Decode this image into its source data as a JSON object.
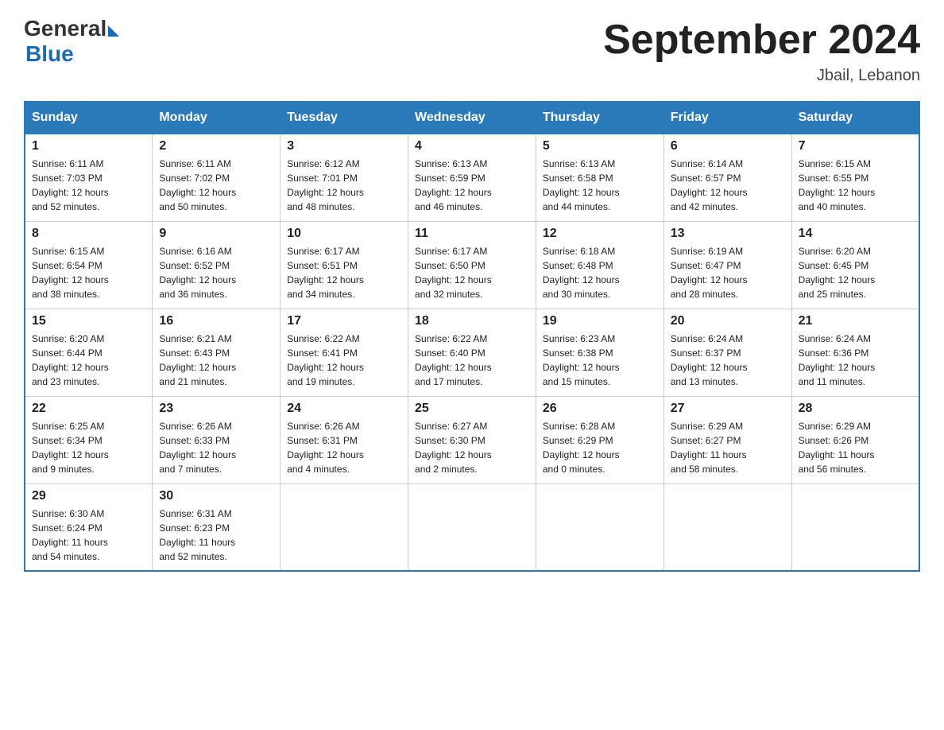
{
  "header": {
    "logo_general": "General",
    "logo_blue": "Blue",
    "title": "September 2024",
    "subtitle": "Jbail, Lebanon"
  },
  "days_of_week": [
    "Sunday",
    "Monday",
    "Tuesday",
    "Wednesday",
    "Thursday",
    "Friday",
    "Saturday"
  ],
  "weeks": [
    [
      {
        "day": "1",
        "sunrise": "6:11 AM",
        "sunset": "7:03 PM",
        "daylight": "12 hours and 52 minutes."
      },
      {
        "day": "2",
        "sunrise": "6:11 AM",
        "sunset": "7:02 PM",
        "daylight": "12 hours and 50 minutes."
      },
      {
        "day": "3",
        "sunrise": "6:12 AM",
        "sunset": "7:01 PM",
        "daylight": "12 hours and 48 minutes."
      },
      {
        "day": "4",
        "sunrise": "6:13 AM",
        "sunset": "6:59 PM",
        "daylight": "12 hours and 46 minutes."
      },
      {
        "day": "5",
        "sunrise": "6:13 AM",
        "sunset": "6:58 PM",
        "daylight": "12 hours and 44 minutes."
      },
      {
        "day": "6",
        "sunrise": "6:14 AM",
        "sunset": "6:57 PM",
        "daylight": "12 hours and 42 minutes."
      },
      {
        "day": "7",
        "sunrise": "6:15 AM",
        "sunset": "6:55 PM",
        "daylight": "12 hours and 40 minutes."
      }
    ],
    [
      {
        "day": "8",
        "sunrise": "6:15 AM",
        "sunset": "6:54 PM",
        "daylight": "12 hours and 38 minutes."
      },
      {
        "day": "9",
        "sunrise": "6:16 AM",
        "sunset": "6:52 PM",
        "daylight": "12 hours and 36 minutes."
      },
      {
        "day": "10",
        "sunrise": "6:17 AM",
        "sunset": "6:51 PM",
        "daylight": "12 hours and 34 minutes."
      },
      {
        "day": "11",
        "sunrise": "6:17 AM",
        "sunset": "6:50 PM",
        "daylight": "12 hours and 32 minutes."
      },
      {
        "day": "12",
        "sunrise": "6:18 AM",
        "sunset": "6:48 PM",
        "daylight": "12 hours and 30 minutes."
      },
      {
        "day": "13",
        "sunrise": "6:19 AM",
        "sunset": "6:47 PM",
        "daylight": "12 hours and 28 minutes."
      },
      {
        "day": "14",
        "sunrise": "6:20 AM",
        "sunset": "6:45 PM",
        "daylight": "12 hours and 25 minutes."
      }
    ],
    [
      {
        "day": "15",
        "sunrise": "6:20 AM",
        "sunset": "6:44 PM",
        "daylight": "12 hours and 23 minutes."
      },
      {
        "day": "16",
        "sunrise": "6:21 AM",
        "sunset": "6:43 PM",
        "daylight": "12 hours and 21 minutes."
      },
      {
        "day": "17",
        "sunrise": "6:22 AM",
        "sunset": "6:41 PM",
        "daylight": "12 hours and 19 minutes."
      },
      {
        "day": "18",
        "sunrise": "6:22 AM",
        "sunset": "6:40 PM",
        "daylight": "12 hours and 17 minutes."
      },
      {
        "day": "19",
        "sunrise": "6:23 AM",
        "sunset": "6:38 PM",
        "daylight": "12 hours and 15 minutes."
      },
      {
        "day": "20",
        "sunrise": "6:24 AM",
        "sunset": "6:37 PM",
        "daylight": "12 hours and 13 minutes."
      },
      {
        "day": "21",
        "sunrise": "6:24 AM",
        "sunset": "6:36 PM",
        "daylight": "12 hours and 11 minutes."
      }
    ],
    [
      {
        "day": "22",
        "sunrise": "6:25 AM",
        "sunset": "6:34 PM",
        "daylight": "12 hours and 9 minutes."
      },
      {
        "day": "23",
        "sunrise": "6:26 AM",
        "sunset": "6:33 PM",
        "daylight": "12 hours and 7 minutes."
      },
      {
        "day": "24",
        "sunrise": "6:26 AM",
        "sunset": "6:31 PM",
        "daylight": "12 hours and 4 minutes."
      },
      {
        "day": "25",
        "sunrise": "6:27 AM",
        "sunset": "6:30 PM",
        "daylight": "12 hours and 2 minutes."
      },
      {
        "day": "26",
        "sunrise": "6:28 AM",
        "sunset": "6:29 PM",
        "daylight": "12 hours and 0 minutes."
      },
      {
        "day": "27",
        "sunrise": "6:29 AM",
        "sunset": "6:27 PM",
        "daylight": "11 hours and 58 minutes."
      },
      {
        "day": "28",
        "sunrise": "6:29 AM",
        "sunset": "6:26 PM",
        "daylight": "11 hours and 56 minutes."
      }
    ],
    [
      {
        "day": "29",
        "sunrise": "6:30 AM",
        "sunset": "6:24 PM",
        "daylight": "11 hours and 54 minutes."
      },
      {
        "day": "30",
        "sunrise": "6:31 AM",
        "sunset": "6:23 PM",
        "daylight": "11 hours and 52 minutes."
      },
      null,
      null,
      null,
      null,
      null
    ]
  ],
  "labels": {
    "sunrise": "Sunrise:",
    "sunset": "Sunset:",
    "daylight": "Daylight:"
  }
}
